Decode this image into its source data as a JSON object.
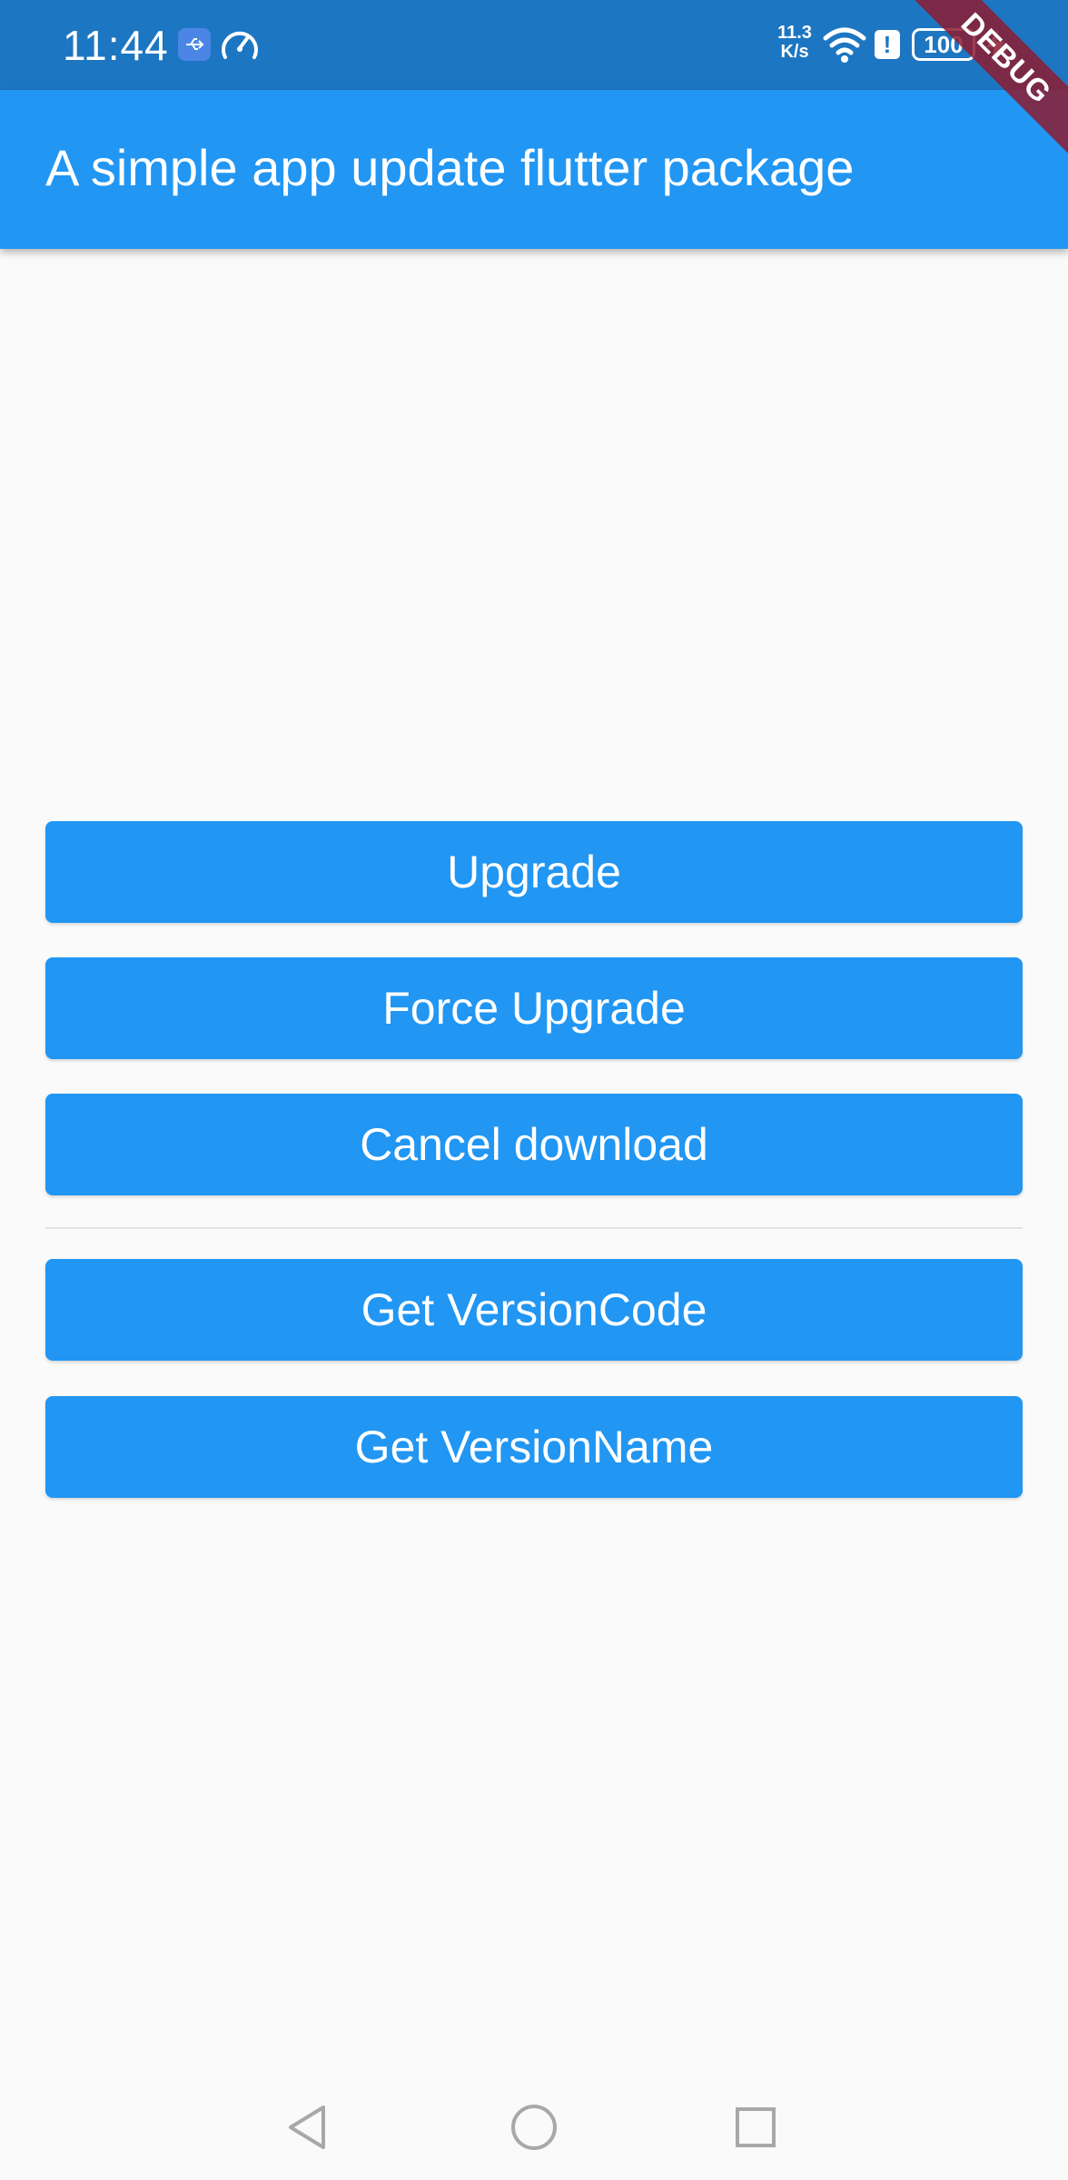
{
  "status_bar": {
    "time": "11:44",
    "net_speed_value": "11.3",
    "net_speed_unit": "K/s",
    "alert_glyph": "!",
    "battery_level": "100",
    "icons": [
      "usb-icon",
      "speed-gauge-icon",
      "wifi-icon",
      "alert-icon",
      "battery-icon",
      "charge-icon"
    ]
  },
  "app_bar": {
    "title": "A simple app update flutter package"
  },
  "debug_banner": {
    "label": "DEBUG"
  },
  "buttons": {
    "upgrade": "Upgrade",
    "force_upgrade": "Force Upgrade",
    "cancel_download": "Cancel download",
    "get_version_code": "Get VersionCode",
    "get_version_name": "Get VersionName"
  },
  "nav_bar": {
    "icons": [
      "back-icon",
      "home-icon",
      "recents-icon"
    ]
  },
  "colors": {
    "primary": "#2196f3",
    "status_bar": "#1d76c1",
    "background": "#fafafa",
    "debug_banner": "#8c1c30"
  }
}
